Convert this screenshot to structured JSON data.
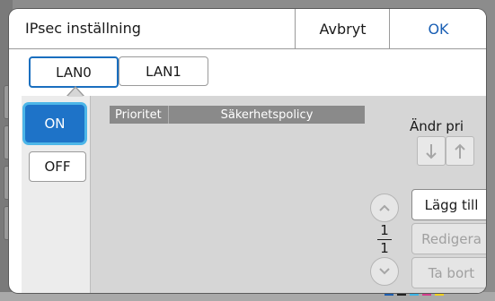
{
  "dialog": {
    "title": "IPsec inställning",
    "cancel_label": "Avbryt",
    "ok_label": "OK"
  },
  "tabs": [
    {
      "label": "LAN0",
      "active": true
    },
    {
      "label": "LAN1",
      "active": false
    }
  ],
  "toggle": {
    "on_label": "ON",
    "off_label": "OFF",
    "selected": "ON"
  },
  "list": {
    "headers": {
      "priority": "Prioritet",
      "policy": "Säkerhetspolicy"
    },
    "rows": []
  },
  "priority_change": {
    "label": "Ändr pri",
    "down_icon": "arrow-down-icon",
    "up_icon": "arrow-up-icon"
  },
  "pagination": {
    "current": "1",
    "total": "1"
  },
  "actions": {
    "add_label": "Lägg till",
    "edit_label": "Redigera",
    "delete_label": "Ta bort"
  },
  "colors": {
    "accent": "#1e73c8",
    "focus_ring": "#4db6e8",
    "ok_text": "#1a5fb4",
    "header_bg": "#8a8a8a",
    "panel_bg": "#d6d6d6"
  }
}
